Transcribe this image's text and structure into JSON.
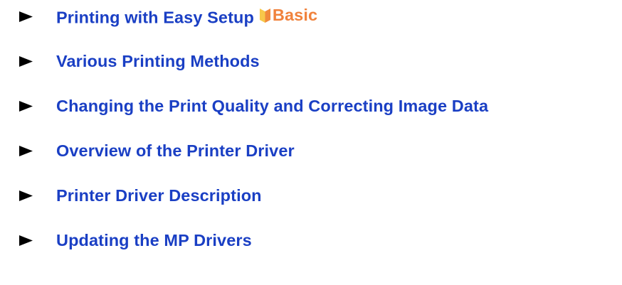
{
  "links": [
    {
      "label": "Printing with Easy Setup",
      "badge": "Basic"
    },
    {
      "label": "Various Printing Methods"
    },
    {
      "label": "Changing the Print Quality and Correcting Image Data"
    },
    {
      "label": "Overview of the Printer Driver"
    },
    {
      "label": "Printer Driver Description"
    },
    {
      "label": "Updating the MP Drivers"
    }
  ],
  "colors": {
    "link": "#1a3fc4",
    "arrow": "#000000",
    "badge_text": "#f0823c",
    "badge_icon_left": "#f7c84a",
    "badge_icon_right": "#f08a3c"
  },
  "icons": {
    "bullet": "triangle-arrow-icon",
    "badge": "beginner-leaf-icon"
  }
}
